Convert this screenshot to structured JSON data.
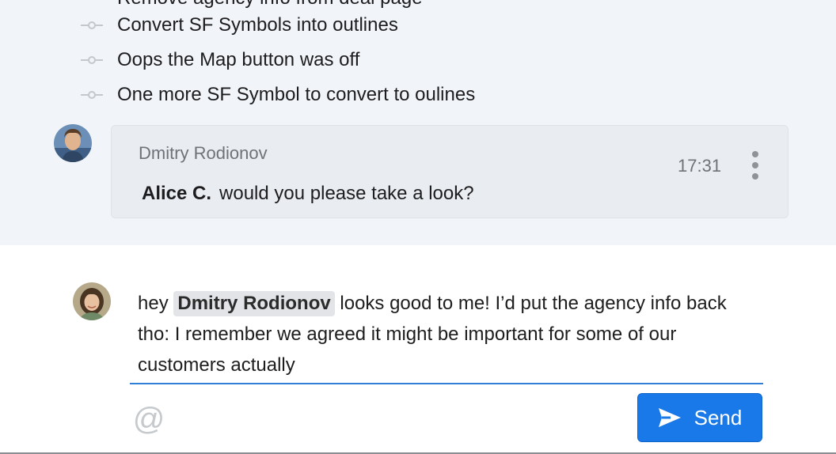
{
  "thread": {
    "partial_commit": "Remove agency info from deal page",
    "commits": [
      {
        "label": "Convert SF Symbols into outlines"
      },
      {
        "label": "Oops the Map button was off"
      },
      {
        "label": "One more SF Symbol to convert to oulines"
      }
    ],
    "message": {
      "author": "Dmitry Rodionov",
      "time": "17:31",
      "mention": "Alice C.",
      "text": "would you please take a look?"
    }
  },
  "composer": {
    "prefix": "hey",
    "mention": "Dmitry Rodionov",
    "text": "looks good to me! I’d put the agency info back tho: I remember we agreed it might be important for some of our customers actually",
    "mention_symbol": "@",
    "send_label": "Send"
  },
  "colors": {
    "thread_background": "#f1f4f8",
    "card_background": "#e9ecf0",
    "accent": "#1a79e8"
  }
}
